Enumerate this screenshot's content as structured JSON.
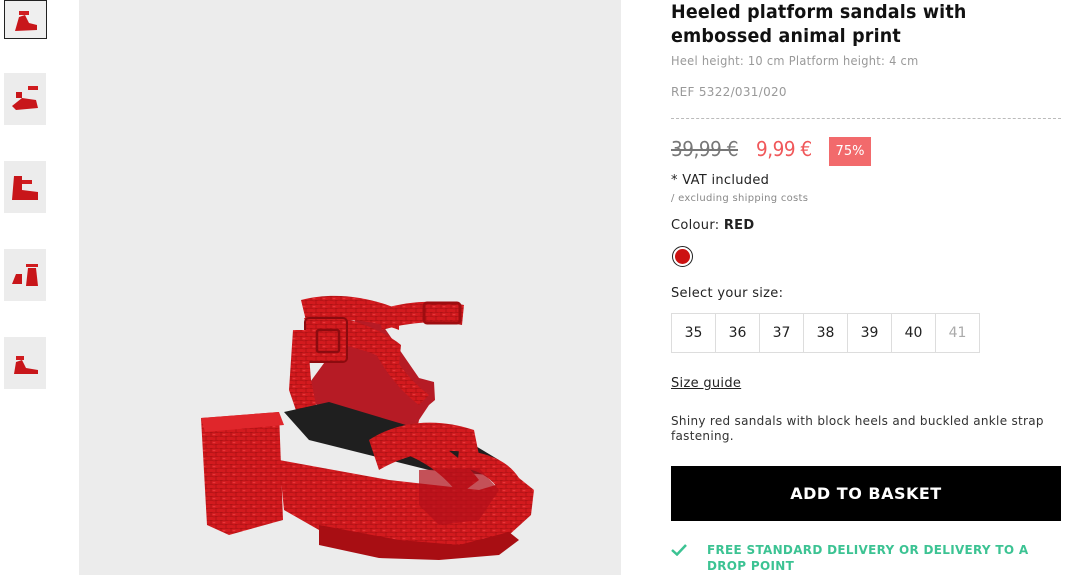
{
  "thumbnails": [
    {
      "label": "thumbnail-1",
      "active": true
    },
    {
      "label": "thumbnail-2",
      "active": false
    },
    {
      "label": "thumbnail-3",
      "active": false
    },
    {
      "label": "thumbnail-4",
      "active": false
    },
    {
      "label": "thumbnail-5",
      "active": false
    }
  ],
  "product": {
    "title": "Heeled platform sandals with\nembossed animal print",
    "dimensions": "Heel height: 10 cm Platform height: 4 cm",
    "ref": "REF 5322/031/020",
    "old_price": "39,99 €",
    "new_price": "9,99 €",
    "discount": "75%",
    "vat": "* VAT included",
    "shipping": "/ excluding shipping costs",
    "colour_prefix": "Colour: ",
    "colour_value": "RED",
    "colour_hex": "#cc1111",
    "size_label": "Select your size:",
    "sizes": [
      {
        "value": "35",
        "available": true
      },
      {
        "value": "36",
        "available": true
      },
      {
        "value": "37",
        "available": true
      },
      {
        "value": "38",
        "available": true
      },
      {
        "value": "39",
        "available": true
      },
      {
        "value": "40",
        "available": true
      },
      {
        "value": "41",
        "available": false
      }
    ],
    "size_guide": "Size guide",
    "description": "Shiny red sandals with block heels and buckled ankle strap fastening.",
    "add_to_basket": "ADD TO BASKET",
    "delivery": "FREE STANDARD DELIVERY OR DELIVERY TO A DROP POINT"
  },
  "colors": {
    "accent_red": "#f0585a",
    "badge_red": "#f26a6c",
    "delivery_green": "#3cc393",
    "button_black": "#000000"
  }
}
